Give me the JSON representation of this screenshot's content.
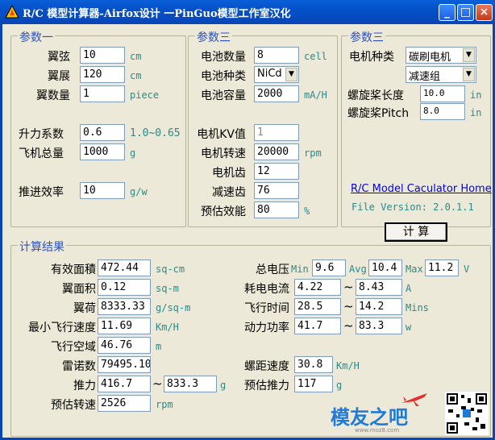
{
  "window": {
    "title": "R/C 模型计算器-Airfox设计 一PinGuo模型工作室汉化"
  },
  "group1": {
    "title": "参数一",
    "chord_label": "翼弦",
    "chord": "10",
    "chord_unit": "cm",
    "span_label": "翼展",
    "span": "120",
    "span_unit": "cm",
    "count_label": "翼数量",
    "count": "1",
    "count_unit": "piece",
    "lift_label": "升力系数",
    "lift": "0.6",
    "lift_range": "1.0~0.65",
    "weight_label": "飞机总量",
    "weight": "1000",
    "weight_unit": "g",
    "eff_label": "推进效率",
    "eff": "10",
    "eff_unit": "g/w"
  },
  "group2": {
    "title": "参数三",
    "cells_label": "电池数量",
    "cells": "8",
    "cells_unit": "cell",
    "type_label": "电池种类",
    "type": "NiCd",
    "cap_label": "电池容量",
    "cap": "2000",
    "cap_unit": "mA/H",
    "kv_label": "电机KV值",
    "kv": "1",
    "rpm_label": "电机转速",
    "rpm": "20000",
    "rpm_unit": "rpm",
    "gear_label": "电机齿",
    "gear": "12",
    "red_label": "减速齿",
    "red": "76",
    "peff_label": "预估效能",
    "peff": "80",
    "peff_unit": "%"
  },
  "group3": {
    "title": "参数三",
    "motor_label": "电机种类",
    "motor": "碳刷电机",
    "gearbox": "减速组",
    "pd_label": "螺旋桨长度",
    "pd": "10.0",
    "pd_unit": "in",
    "pp_label": "螺旋桨Pitch",
    "pp": "8.0",
    "pp_unit": "in",
    "home": "R/C Model Caculator Home",
    "version": "File Version: 2.0.1.1",
    "calc": "计  算"
  },
  "results": {
    "title": "计算结果",
    "area_label": "有效面積",
    "area": "472.44",
    "area_unit": "sq-cm",
    "warea_label": "翼面积",
    "warea": "0.12",
    "warea_unit": "sq-m",
    "load_label": "翼荷",
    "load": "8333.33",
    "load_unit": "g/sq-m",
    "minv_label": "最小飞行速度",
    "minv": "11.69",
    "minv_unit": "Km/H",
    "space_label": "飞行空域",
    "space": "46.76",
    "space_unit": "m",
    "re_label": "雷诺数",
    "re": "79495.10",
    "thrust_label": "推力",
    "thrust_min": "416.7",
    "thrust_max": "833.3",
    "thrust_unit": "g",
    "erpm_label": "预估转速",
    "erpm": "2526",
    "erpm_unit": "rpm",
    "volt_label": "总电压",
    "volt_min_l": "Min",
    "volt_min": "9.6",
    "volt_avg_l": "Avg",
    "volt_avg": "10.4",
    "volt_max_l": "Max",
    "volt_max": "11.2",
    "volt_unit": "V",
    "cur_label": "耗电电流",
    "cur_min": "4.22",
    "cur_max": "8.43",
    "cur_unit": "A",
    "time_label": "飞行时间",
    "time_min": "28.5",
    "time_max": "14.2",
    "time_unit": "Mins",
    "pow_label": "动力功率",
    "pow_min": "41.7",
    "pow_max": "83.3",
    "pow_unit": "w",
    "pspeed_label": "螺距速度",
    "pspeed": "30.8",
    "pspeed_unit": "Km/H",
    "ethrust_label": "预估推力",
    "ethrust": "117",
    "ethrust_unit": "g",
    "tilde": "~"
  },
  "watermark": {
    "text": "模友之吧",
    "url": "www.moz8.com"
  }
}
